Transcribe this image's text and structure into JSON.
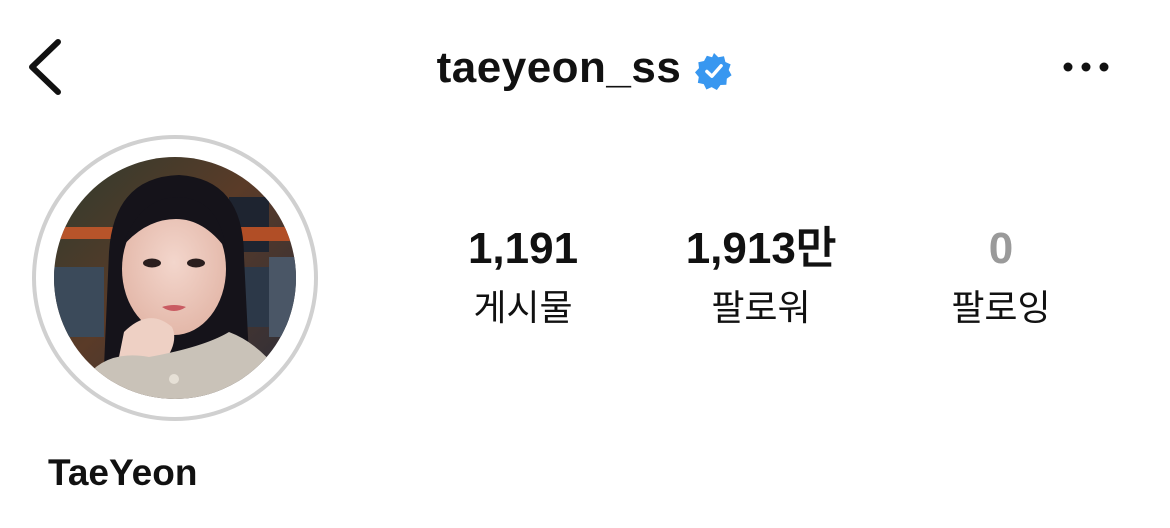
{
  "header": {
    "username": "taeyeon_ss",
    "verified": true,
    "back_icon": "chevron-left-icon",
    "more_icon": "more-horizontal-icon",
    "verified_color": "#3897f0"
  },
  "profile": {
    "display_name": "TaeYeon",
    "avatar_ring_color": "#d0d0d0"
  },
  "stats": [
    {
      "value": "1,191",
      "label": "게시물"
    },
    {
      "value": "1,913만",
      "label": "팔로워"
    },
    {
      "value": "0",
      "label": "팔로잉"
    }
  ]
}
